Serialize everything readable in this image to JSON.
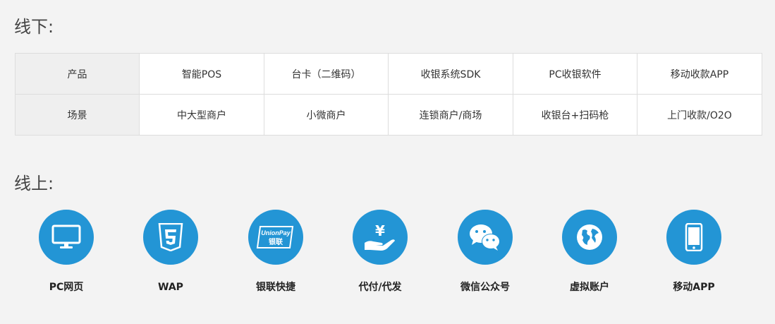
{
  "offline": {
    "title": "线下:",
    "rows": [
      {
        "header": "产品",
        "cells": [
          "智能POS",
          "台卡（二维码）",
          "收银系统SDK",
          "PC收银软件",
          "移动收款APP"
        ]
      },
      {
        "header": "场景",
        "cells": [
          "中大型商户",
          "小微商户",
          "连锁商户/商场",
          "收银台+扫码枪",
          "上门收款/O2O"
        ]
      }
    ]
  },
  "online": {
    "title": "线上:",
    "channels": [
      {
        "label": "PC网页",
        "icon": "monitor-icon"
      },
      {
        "label": "WAP",
        "icon": "html5-icon"
      },
      {
        "label": "银联快捷",
        "icon": "unionpay-card-icon",
        "icon_text": [
          "UnionPay",
          "银联"
        ]
      },
      {
        "label": "代付/代发",
        "icon": "yuan-hand-icon",
        "icon_text": "¥"
      },
      {
        "label": "微信公众号",
        "icon": "wechat-icon"
      },
      {
        "label": "虚拟账户",
        "icon": "globe-icon"
      },
      {
        "label": "移动APP",
        "icon": "smartphone-icon"
      }
    ]
  },
  "colors": {
    "accent": "#2395d5",
    "background": "#f3f3f3",
    "table_header_bg": "#efefef",
    "border": "#dddddd"
  }
}
